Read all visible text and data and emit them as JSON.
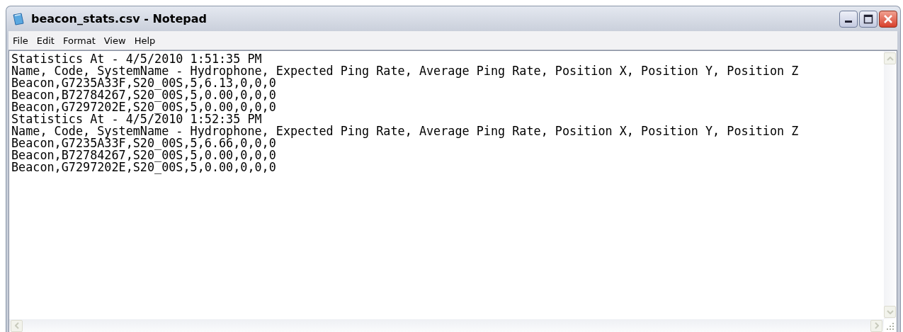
{
  "window": {
    "title": "beacon_stats.csv - Notepad"
  },
  "menu": [
    "File",
    "Edit",
    "Format",
    "View",
    "Help"
  ],
  "lines": [
    "Statistics At - 4/5/2010 1:51:35 PM",
    "Name, Code, SystemName - Hydrophone, Expected Ping Rate, Average Ping Rate, Position X, Position Y, Position Z",
    "Beacon,G7235A33F,S20_00S,5,6.13,0,0,0",
    "Beacon,B72784267,S20_00S,5,0.00,0,0,0",
    "Beacon,G7297202E,S20_00S,5,0.00,0,0,0",
    "Statistics At - 4/5/2010 1:52:35 PM",
    "Name, Code, SystemName - Hydrophone, Expected Ping Rate, Average Ping Rate, Position X, Position Y, Position Z",
    "Beacon,G7235A33F,S20_00S,5,6.66,0,0,0",
    "Beacon,B72784267,S20_00S,5,0.00,0,0,0",
    "Beacon,G7297202E,S20_00S,5,0.00,0,0,0"
  ]
}
